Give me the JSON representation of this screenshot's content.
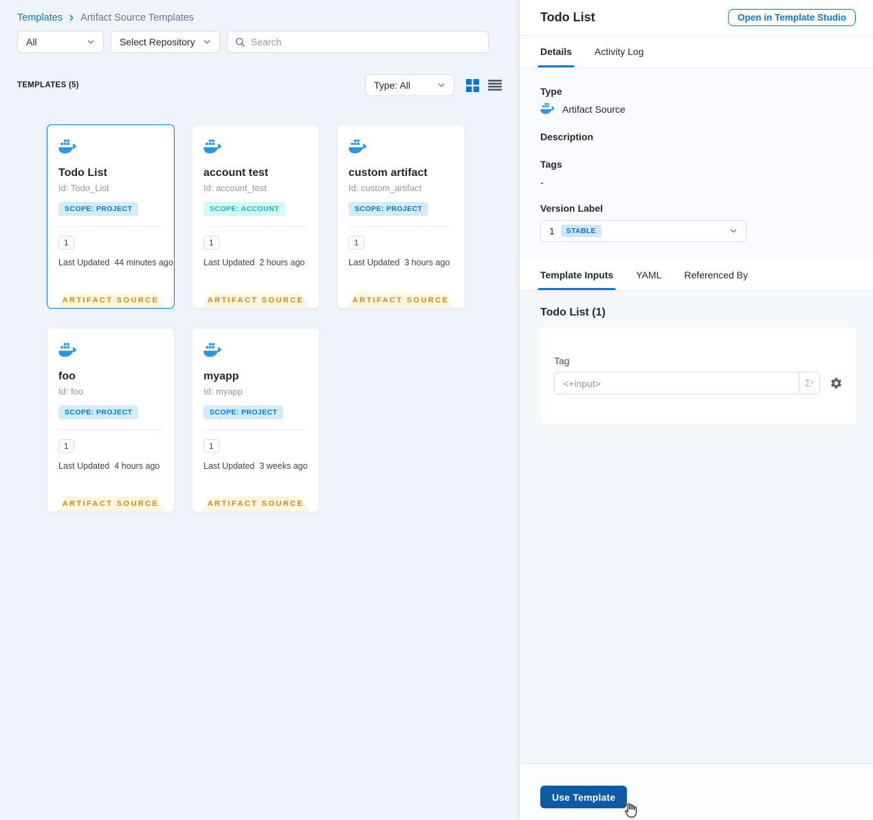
{
  "breadcrumb": {
    "root": "Templates",
    "current": "Artifact Source Templates"
  },
  "filters": {
    "scope": "All",
    "repository": "Select Repository",
    "search_placeholder": "Search"
  },
  "list_header": {
    "count_label": "TEMPLATES (5)",
    "type_filter": "Type: All"
  },
  "cards": [
    {
      "title": "Todo List",
      "id": "Id: Todo_List",
      "scope": "SCOPE: PROJECT",
      "version": "1",
      "updated_label": "Last Updated",
      "updated_value": "44 minutes ago",
      "ribbon": "ARTIFACT SOURCE"
    },
    {
      "title": "account test",
      "id": "Id: account_test",
      "scope": "SCOPE: ACCOUNT",
      "version": "1",
      "updated_label": "Last Updated",
      "updated_value": "2 hours ago",
      "ribbon": "ARTIFACT SOURCE"
    },
    {
      "title": "custom artifact",
      "id": "Id: custom_artifact",
      "scope": "SCOPE: PROJECT",
      "version": "1",
      "updated_label": "Last Updated",
      "updated_value": "3 hours ago",
      "ribbon": "ARTIFACT SOURCE"
    },
    {
      "title": "foo",
      "id": "Id: foo",
      "scope": "SCOPE: PROJECT",
      "version": "1",
      "updated_label": "Last Updated",
      "updated_value": "4 hours ago",
      "ribbon": "ARTIFACT SOURCE"
    },
    {
      "title": "myapp",
      "id": "Id: myapp",
      "scope": "SCOPE: PROJECT",
      "version": "1",
      "updated_label": "Last Updated",
      "updated_value": "3 weeks ago",
      "ribbon": "ARTIFACT SOURCE"
    }
  ],
  "panel": {
    "title": "Todo List",
    "open_button": "Open in Template Studio",
    "tabs": {
      "details": "Details",
      "activity_log": "Activity Log"
    },
    "details": {
      "type_label": "Type",
      "type_value": "Artifact Source",
      "description_label": "Description",
      "tags_label": "Tags",
      "tags_value": "-",
      "version_label": "Version Label",
      "version_value": "1",
      "version_badge": "STABLE"
    },
    "input_tabs": {
      "template_inputs": "Template Inputs",
      "yaml": "YAML",
      "referenced_by": "Referenced By"
    },
    "inputs": {
      "heading": "Todo List (1)",
      "tag_label": "Tag",
      "tag_value": "<+input>",
      "expression_symbol": "Σˣ"
    },
    "footer": {
      "use_template": "Use Template"
    }
  },
  "colors": {
    "link_blue": "#0278d5",
    "docker_blue": "#2496ed",
    "primary_button": "#0d5aa6",
    "ribbon_bg": "#fdf5df",
    "ribbon_text": "#cf8c10",
    "scope_project_bg": "#d1ecfc",
    "scope_project_text": "#0278d5",
    "scope_account_bg": "#d4f9f9",
    "scope_account_text": "#0ab8c4",
    "stable_badge_bg": "#cde7fe"
  }
}
